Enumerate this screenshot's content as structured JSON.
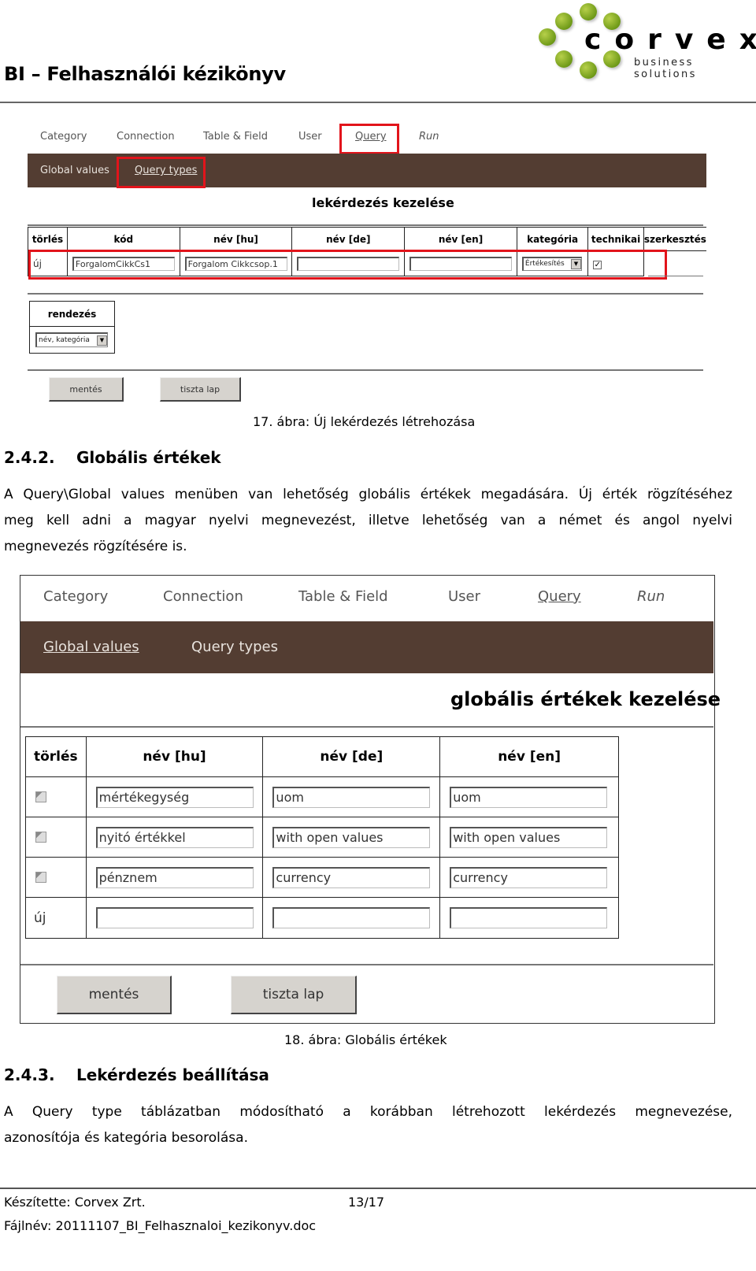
{
  "header": {
    "title": "BI – Felhasználói kézikönyv",
    "logo": {
      "word": "corvex",
      "tagline": "business solutions",
      "accent_color": "#7aa51f"
    }
  },
  "figure17": {
    "top_nav": [
      {
        "label": "Category"
      },
      {
        "label": "Connection"
      },
      {
        "label": "Table & Field"
      },
      {
        "label": "User"
      },
      {
        "label": "Query",
        "active": true,
        "highlighted": true
      },
      {
        "label": "Run",
        "italic": true
      }
    ],
    "sub_nav": [
      {
        "label": "Global values"
      },
      {
        "label": "Query types",
        "active": true,
        "highlighted": true
      }
    ],
    "section_title": "lekérdezés kezelése",
    "table": {
      "columns": [
        "törlés",
        "kód",
        "név [hu]",
        "név [de]",
        "név [en]",
        "kategória",
        "technikai",
        "szerkesztés"
      ],
      "new_row": {
        "label": "új",
        "kod": "ForgalomCikkCs1",
        "nev_hu": "Forgalom Cikkcsop.1",
        "nev_de": "",
        "nev_en": "",
        "kategoria": "Értékesítés",
        "technikai": true
      }
    },
    "sort": {
      "label": "rendezés",
      "value": "név, kategória"
    },
    "buttons": {
      "save": "mentés",
      "clear": "tiszta lap"
    },
    "caption": "17. ábra: Új lekérdezés létrehozása",
    "highlight_color": "#e2141b",
    "subnav_color": "#533d32"
  },
  "section_242": {
    "number": "2.4.2.",
    "title": "Globális értékek",
    "paragraph": [
      "A Query\\Global values menüben van lehetőség globális értékek megadására. Új érték rögzítéséhez",
      "meg kell adni a magyar nyelvi megnevezést, illetve lehetőség van a német és angol nyelvi",
      "megnevezés rögzítésére is."
    ]
  },
  "figure18": {
    "top_nav": [
      {
        "label": "Category"
      },
      {
        "label": "Connection"
      },
      {
        "label": "Table & Field"
      },
      {
        "label": "User"
      },
      {
        "label": "Query",
        "active": true
      },
      {
        "label": "Run",
        "italic": true
      }
    ],
    "sub_nav": [
      {
        "label": "Global values",
        "active": true
      },
      {
        "label": "Query types"
      }
    ],
    "section_title": "globális értékek kezelése",
    "table": {
      "columns": [
        "törlés",
        "név [hu]",
        "név [de]",
        "név [en]"
      ],
      "rows": [
        {
          "delete": false,
          "nev_hu": "mértékegység",
          "nev_de": "uom",
          "nev_en": "uom"
        },
        {
          "delete": false,
          "nev_hu": "nyitó értékkel",
          "nev_de": "with open values",
          "nev_en": "with open values"
        },
        {
          "delete": false,
          "nev_hu": "pénznem",
          "nev_de": "currency",
          "nev_en": "currency"
        }
      ],
      "new_row": {
        "label": "új",
        "nev_hu": "",
        "nev_de": "",
        "nev_en": ""
      }
    },
    "buttons": {
      "save": "mentés",
      "clear": "tiszta lap"
    },
    "caption": "18. ábra: Globális értékek"
  },
  "section_243": {
    "number": "2.4.3.",
    "title": "Lekérdezés beállítása",
    "paragraph": [
      "A Query type táblázatban módosítható a korábban létrehozott lekérdezés megnevezése,",
      "azonosítója és kategória besorolása."
    ]
  },
  "footer": {
    "author": "Készítette: Corvex Zrt.",
    "page": "13/17",
    "filename": "Fájlnév: 20111107_BI_Felhasznaloi_kezikonyv.doc"
  }
}
